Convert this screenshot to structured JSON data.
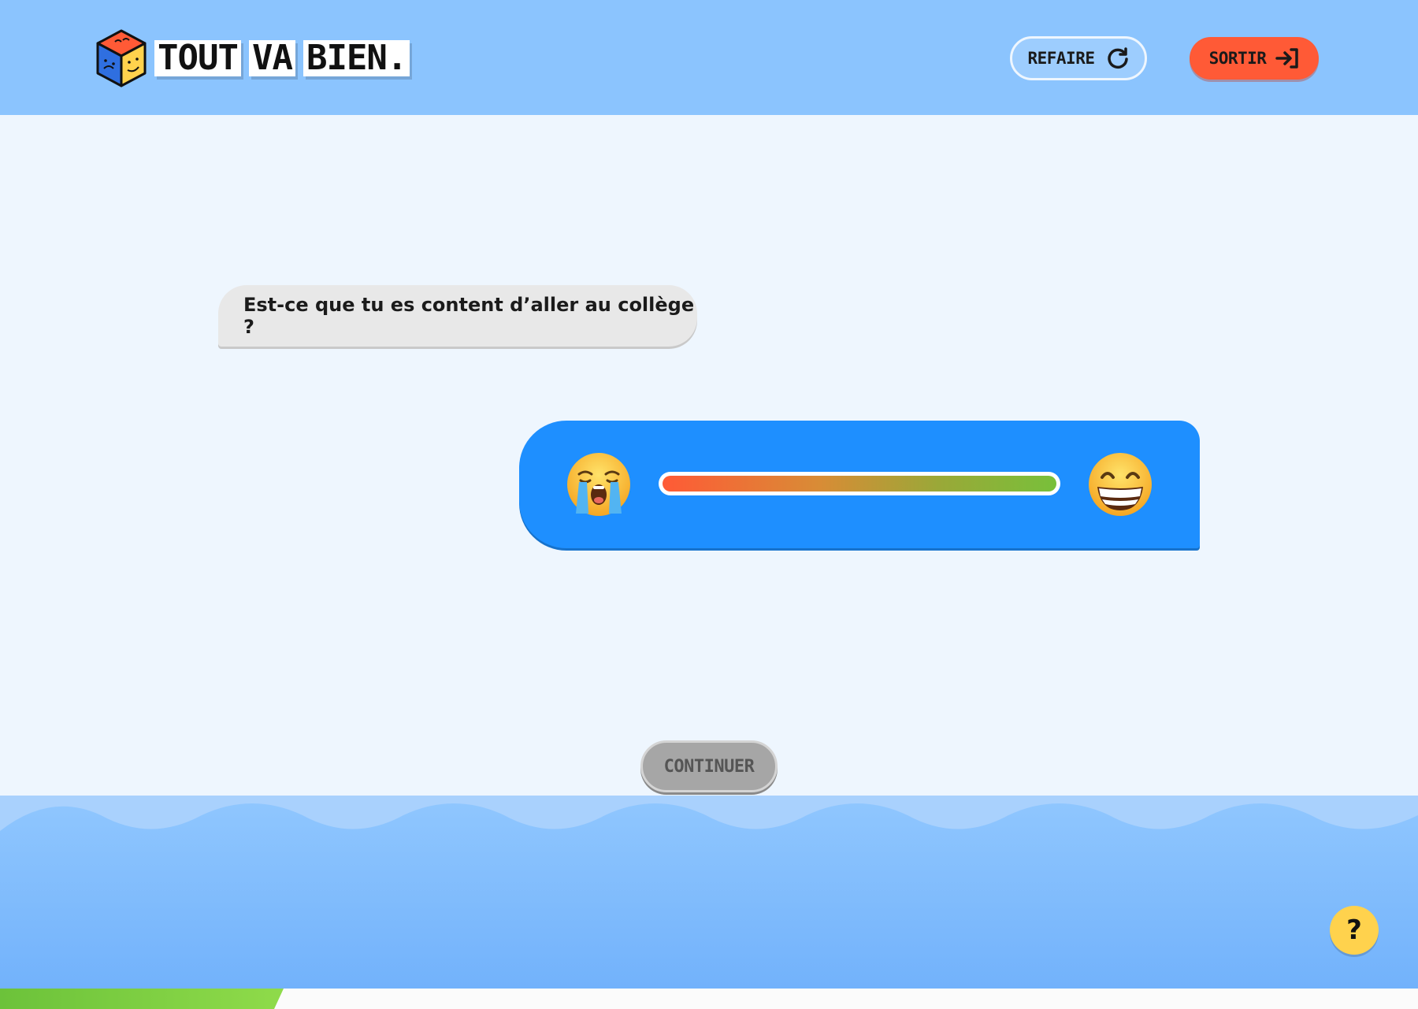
{
  "header": {
    "logo_words": [
      "TOUT",
      "VA",
      "BIEN."
    ],
    "refaire_label": "REFAIRE",
    "sortir_label": "SORTIR",
    "refaire_icon": "refresh-icon",
    "sortir_icon": "exit-icon"
  },
  "conversation": {
    "question": "Est-ce que tu es content d’aller au collège ?",
    "answer_slider": {
      "min_emoji": "loudly-crying-face-emoji",
      "max_emoji": "grinning-face-emoji"
    }
  },
  "footer": {
    "continue_label": "CONTINUER",
    "help_label": "?"
  },
  "progress": {
    "value_fraction": 0.2
  },
  "colors": {
    "header_bg": "#8bc4fe",
    "page_bg": "#eef6fe",
    "sortir_bg": "#ff5a36",
    "answer_bubble": "#1e8fff",
    "question_bubble": "#e8e8e8",
    "continue_disabled": "#a6a6a6",
    "help_bg": "#ffd24d",
    "progress_green": "#7ccf40",
    "wave_front": "#7db9fc",
    "wave_back": "#a9d1fd"
  }
}
